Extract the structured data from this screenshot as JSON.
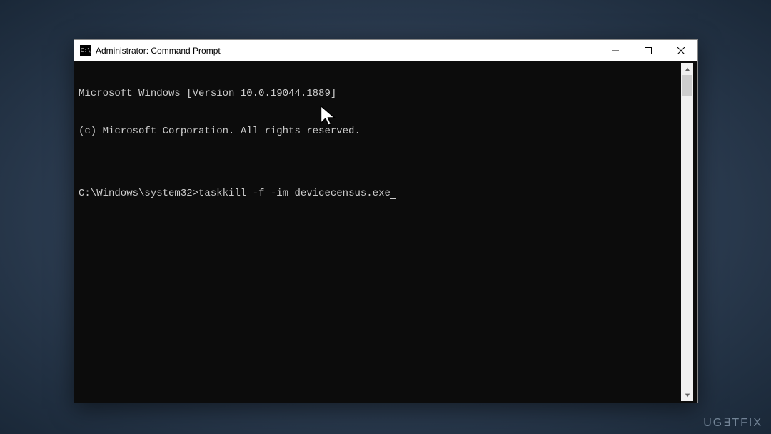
{
  "window": {
    "title": "Administrator: Command Prompt",
    "icon_label": "cmd-icon"
  },
  "terminal": {
    "line1": "Microsoft Windows [Version 10.0.19044.1889]",
    "line2": "(c) Microsoft Corporation. All rights reserved.",
    "blank": "",
    "prompt": "C:\\Windows\\system32>",
    "command": "taskkill -f -im devicecensus.exe"
  },
  "watermark": "UG∃TFIX"
}
